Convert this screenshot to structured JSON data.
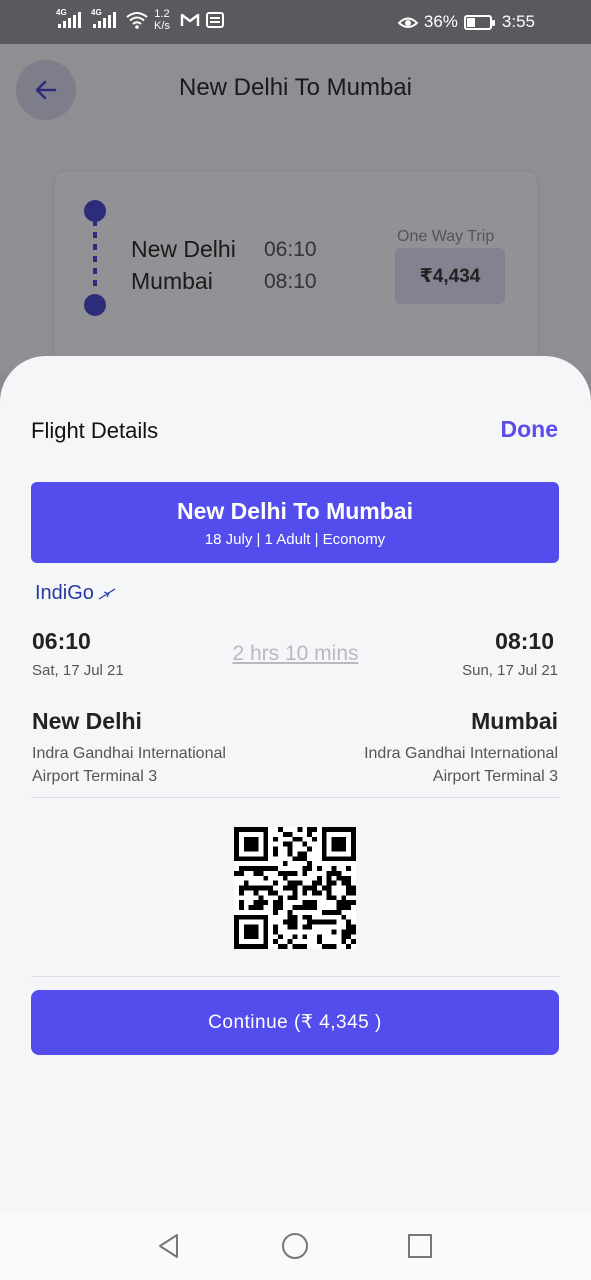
{
  "status_bar": {
    "network_1": "4G",
    "network_2": "4G",
    "speed_value": "1.2",
    "speed_unit": "K/s",
    "battery_percent": "36%",
    "battery_level": 0.36,
    "time": "3:55"
  },
  "background_page": {
    "title": "New Delhi To Mumbai",
    "from_city": "New Delhi",
    "from_time": "06:10",
    "to_city": "Mumbai",
    "to_time": "08:10",
    "trip_type": "One Way Trip",
    "price": "₹4,434"
  },
  "sheet": {
    "title": "Flight Details",
    "done_label": "Done",
    "route_title": "New Delhi To Mumbai",
    "route_subtitle": "18 July | 1 Adult | Economy",
    "airline": "IndiGo",
    "departure": {
      "time": "06:10",
      "date": "Sat, 17 Jul 21",
      "city": "New Delhi",
      "airport_line1": "Indra Gandhai International",
      "airport_line2": "Airport Terminal 3"
    },
    "duration": "2 hrs 10 mins",
    "arrival": {
      "time": "08:10",
      "date": "Sun, 17 Jul 21",
      "city": "Mumbai",
      "airport_line1": "Indra Gandhai International",
      "airport_line2": "Airport Terminal 3"
    },
    "continue_label": "Continue (₹ 4,345 )"
  },
  "colors": {
    "accent": "#544ded",
    "done": "#5b4ee6",
    "airline": "#2638a0"
  },
  "icons": [
    "signal-icon",
    "wifi-icon",
    "gmail-icon",
    "message-icon",
    "eye-icon",
    "battery-icon",
    "back-arrow-icon",
    "plane-icon",
    "qr-code",
    "nav-back-icon",
    "nav-home-icon",
    "nav-recents-icon"
  ]
}
